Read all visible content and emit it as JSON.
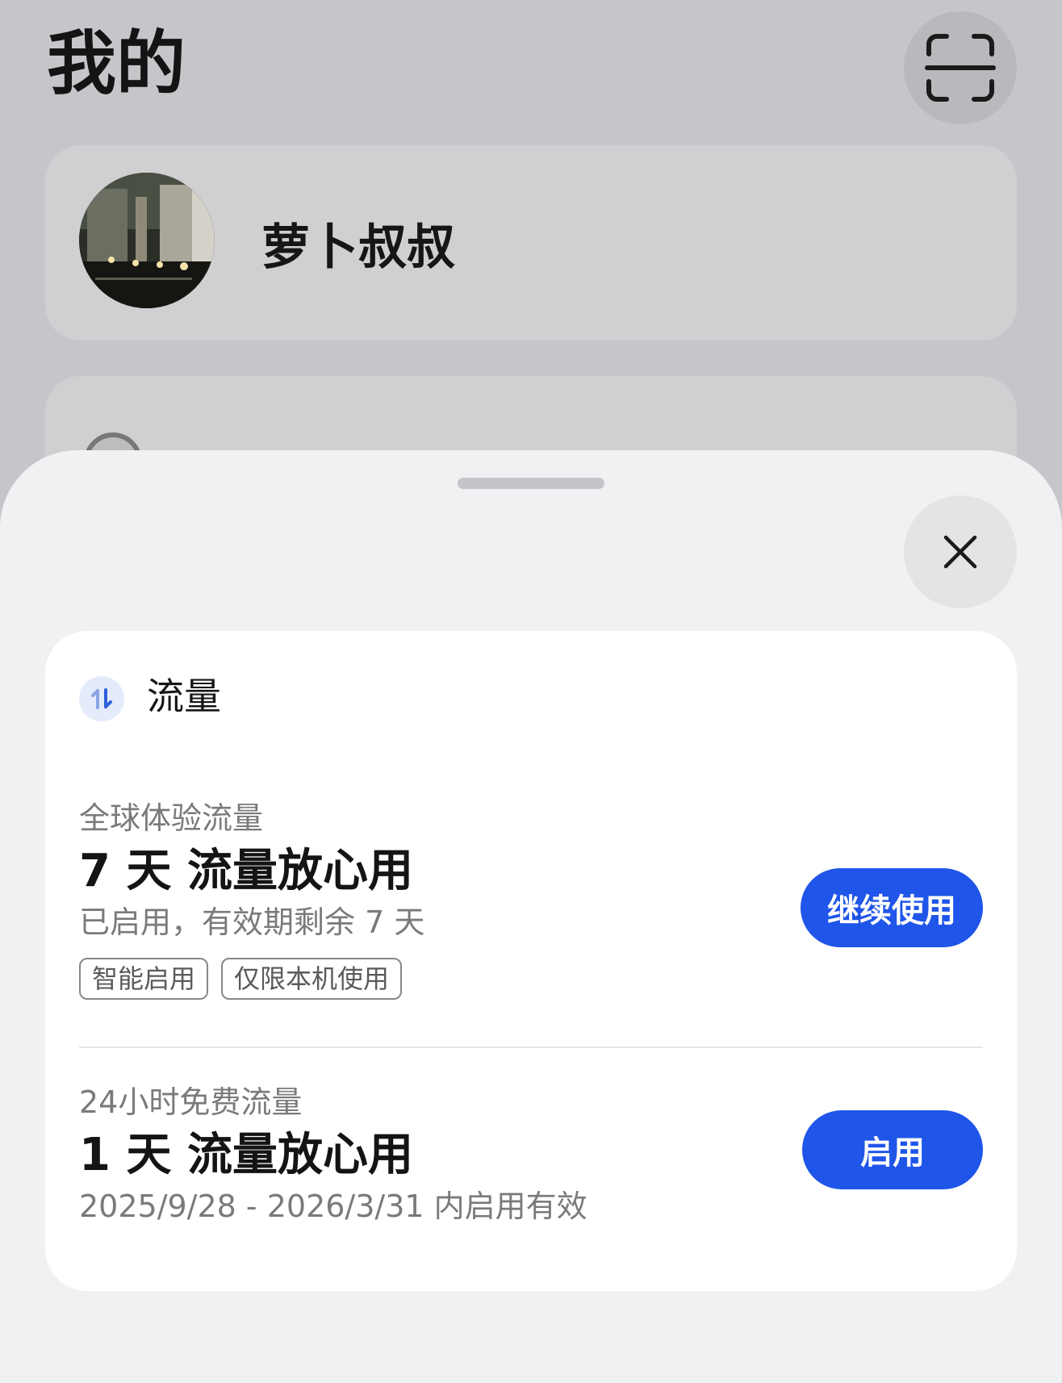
{
  "page": {
    "title": "我的",
    "scan_icon": "scan-icon"
  },
  "profile": {
    "name": "萝卜叔叔",
    "avatar": "avatar-photo"
  },
  "sheet": {
    "close_icon": "close-icon",
    "data_card": {
      "icon": "data-transfer-icon",
      "title": "流量",
      "plans": [
        {
          "subtitle": "全球体验流量",
          "headline": "7 天 流量放心用",
          "status": "已启用，有效期剩余 7 天",
          "tags": [
            "智能启用",
            "仅限本机使用"
          ],
          "button": "继续使用"
        },
        {
          "subtitle": "24小时免费流量",
          "headline": "1 天 流量放心用",
          "status": "2025/9/28 - 2026/3/31 内启用有效",
          "button": "启用"
        }
      ]
    }
  },
  "colors": {
    "accent": "#1f55e8",
    "sheet_bg": "#f0f1f3",
    "overlay_bg": "#c5c6c9"
  }
}
